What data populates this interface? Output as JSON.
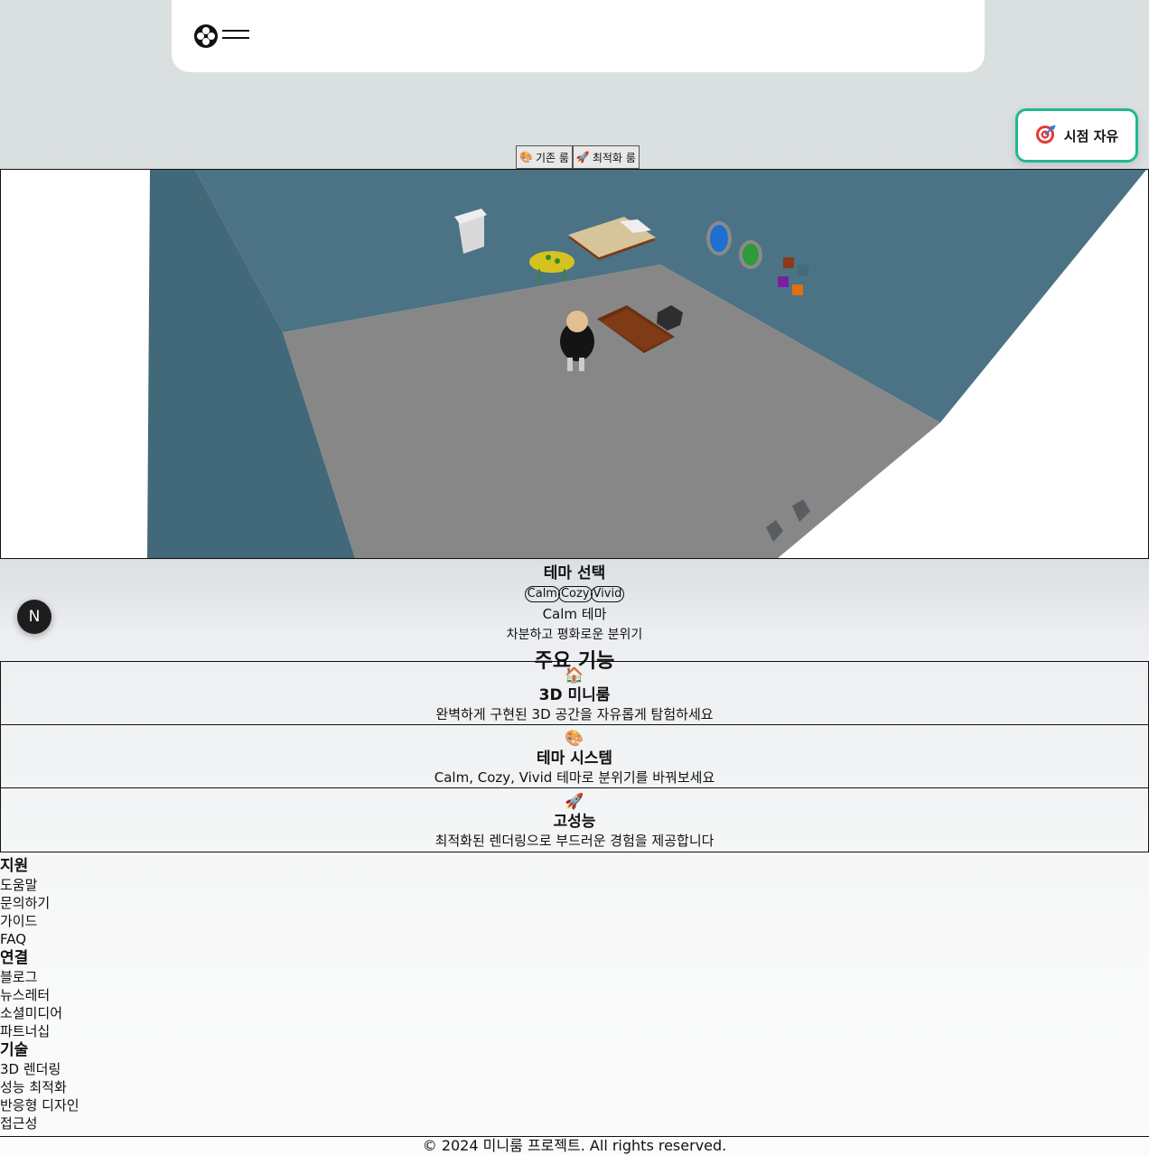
{
  "header": {
    "logo_icon": "film-reel-icon",
    "menu_icon": "menu-icon"
  },
  "view_toggle": {
    "icon": "target-icon",
    "label": "시점 자유"
  },
  "room_switch": [
    {
      "icon": "palette-icon",
      "label": "기존 룸"
    },
    {
      "icon": "rocket-icon",
      "label": "최적화 룸"
    }
  ],
  "theme": {
    "title": "테마 선택",
    "options": [
      "Calm",
      "Cozy",
      "Vivid"
    ],
    "selected": "Calm",
    "current_name": "Calm 테마",
    "current_desc": "차분하고 평화로운 분위기"
  },
  "fab_label": "N",
  "features_heading": "주요 기능",
  "features": [
    {
      "icon": "house-icon",
      "glyph": "🏠",
      "title": "3D 미니룸",
      "desc": "완벽하게 구현된 3D 공간을 자유롭게 탐험하세요"
    },
    {
      "icon": "palette-icon",
      "glyph": "🎨",
      "title": "테마 시스템",
      "desc": "Calm, Cozy, Vivid 테마로 분위기를 바꿔보세요"
    },
    {
      "icon": "rocket-icon",
      "glyph": "🚀",
      "title": "고성능",
      "desc": "최적화된 렌더링으로 부드러운 경험을 제공합니다"
    }
  ],
  "footer": {
    "sections": [
      {
        "title": "지원",
        "links": [
          "도움말",
          "문의하기",
          "가이드",
          "FAQ"
        ]
      },
      {
        "title": "연결",
        "links": [
          "블로그",
          "뉴스레터",
          "소셜미디어",
          "파트너십"
        ]
      },
      {
        "title": "기술",
        "links": [
          "3D 렌더링",
          "성능 최적화",
          "반응형 디자인",
          "접근성"
        ]
      }
    ],
    "copyright": "© 2024 미니룸 프로젝트. All rights reserved."
  },
  "colors": {
    "wall": "#4b7385",
    "floor": "#888888",
    "accent_border": "#21b890"
  }
}
